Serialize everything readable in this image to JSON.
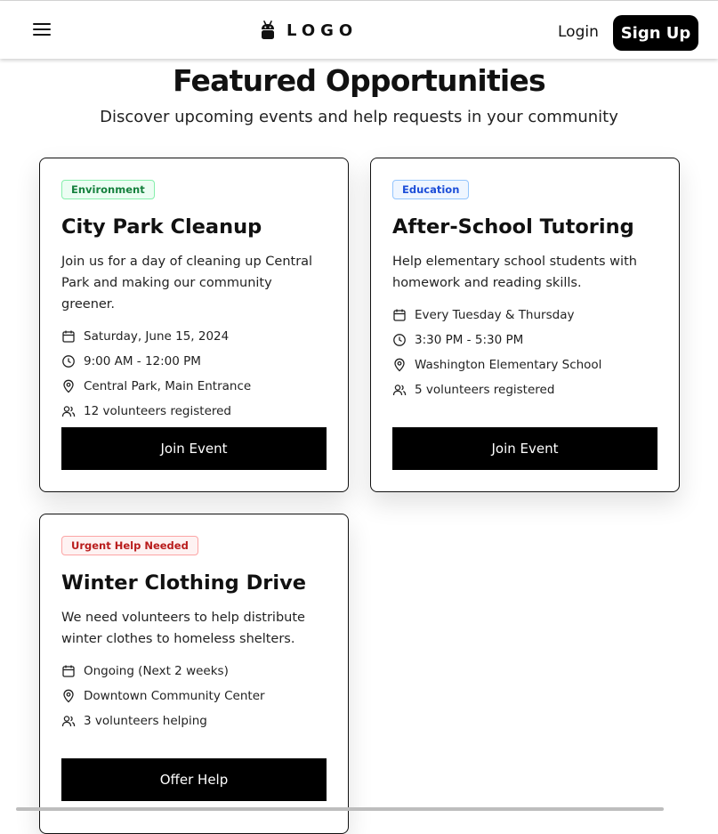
{
  "header": {
    "logo_text": "LOGO",
    "login_label": "Login",
    "signup_label": "Sign Up"
  },
  "hero": {
    "title": "Featured Opportunities",
    "subtitle": "Discover upcoming events and help requests in your community"
  },
  "cards": [
    {
      "badge": "Environment",
      "badge_colors": {
        "text": "#15803d",
        "bg": "#ecfdf3",
        "border": "#86efac"
      },
      "title": "City Park Cleanup",
      "description": "Join us for a day of cleaning up Central Park and making our community greener.",
      "date": "Saturday, June 15, 2024",
      "time": "9:00 AM - 12:00 PM",
      "location": "Central Park, Main Entrance",
      "volunteers": "12 volunteers registered",
      "action_label": "Join Event"
    },
    {
      "badge": "Education",
      "badge_colors": {
        "text": "#1d4ed8",
        "bg": "#eff6ff",
        "border": "#93c5fd"
      },
      "title": "After-School Tutoring",
      "description": "Help elementary school students with homework and reading skills.",
      "date": "Every Tuesday & Thursday",
      "time": "3:30 PM - 5:30 PM",
      "location": "Washington Elementary School",
      "volunteers": "5 volunteers registered",
      "action_label": "Join Event"
    },
    {
      "badge": "Urgent Help Needed",
      "badge_colors": {
        "text": "#b91c1c",
        "bg": "#fef2f2",
        "border": "#fca5a5"
      },
      "title": "Winter Clothing Drive",
      "description": "We need volunteers to help distribute winter clothes to homeless shelters.",
      "date": "Ongoing (Next 2 weeks)",
      "location": "Downtown Community Center",
      "volunteers": "3 volunteers helping",
      "action_label": "Offer Help"
    }
  ]
}
